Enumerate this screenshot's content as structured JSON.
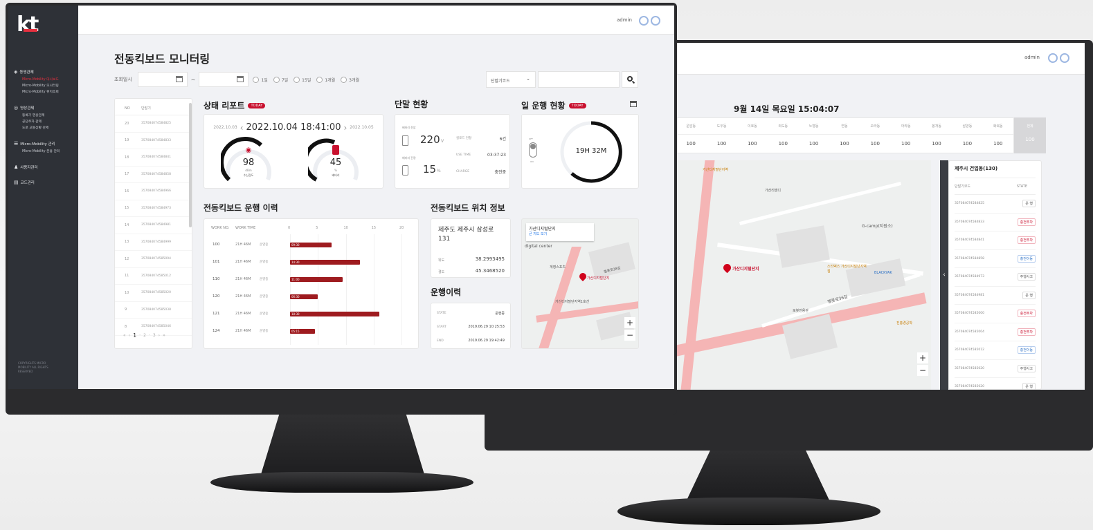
{
  "back": {
    "admin": "admin",
    "datetime": "9월 14일 목요일 15:04:07",
    "top_header": [
      "운암동",
      "도두동",
      "이호동",
      "외도동",
      "노형동",
      "연동",
      "오라동",
      "아라동",
      "봉개동",
      "삼양동",
      "화북동"
    ],
    "top_values": [
      "100",
      "100",
      "100",
      "100",
      "100",
      "100",
      "100",
      "100",
      "100",
      "100",
      "100"
    ],
    "total_header": "전체",
    "total_value": "100",
    "panel_title": "제주시 건입동(130)",
    "panel_cols": [
      "단말기코드",
      "STATE"
    ],
    "panel_rows": [
      {
        "code": "357084074584825",
        "state": "운 행"
      },
      {
        "code": "357084074584833",
        "state": "충전주차"
      },
      {
        "code": "357084074584841",
        "state": "충전주차"
      },
      {
        "code": "357084074584858",
        "state": "충전이동"
      },
      {
        "code": "357084074584973",
        "state": "주행사고"
      },
      {
        "code": "357084074584981",
        "state": "운 행"
      },
      {
        "code": "357084074585000",
        "state": "충전주차"
      },
      {
        "code": "357084074585004",
        "state": "충전주차"
      },
      {
        "code": "357084074585012",
        "state": "충전이동"
      },
      {
        "code": "357084074585020",
        "state": "주행사고"
      },
      {
        "code": "357084074585020",
        "state": "운 행"
      }
    ],
    "map_labels": [
      "가산디지털단지",
      "G-camp(지원소)",
      "BLACKYAK",
      "스타벅스 가산디지털단지역점",
      "로봇전용관",
      "진흥경공학",
      "가산리앤디",
      "벨롯로36길",
      "가산디지털단지역"
    ]
  },
  "front": {
    "logo": "kt",
    "admin": "admin",
    "nav": [
      {
        "group": "동영관제",
        "items": [
          "Micro-Mobility 대시보드",
          "Micro-Mobility 모니터링",
          "Micro-Mobility 위치조회"
        ]
      },
      {
        "group": "영상관제",
        "items": [
          "등록기 영상관제",
          "공단주차 관제",
          "도로 교통상황 관제"
        ]
      },
      {
        "group": "Micro-Mobility 관리",
        "items": [
          "Micro-Mobility 운용 관리"
        ]
      },
      {
        "group": "사용자관리",
        "items": []
      },
      {
        "group": "코드관리",
        "items": []
      }
    ],
    "copyright": "COPYRIGHTS MICRO MOBILITY ALL RIGHTS RESERVED",
    "page_title": "전동킥보드 모니터링",
    "filter": {
      "label": "조회일시",
      "tilde": "~",
      "periods": [
        "1일",
        "7일",
        "15일",
        "1개월",
        "3개월"
      ],
      "select": "단말기코드"
    },
    "list": {
      "cols": [
        "NO",
        "단말기"
      ],
      "rows": [
        {
          "no": "20",
          "code": "357084074584825"
        },
        {
          "no": "19",
          "code": "357084074584833"
        },
        {
          "no": "18",
          "code": "357084074584841"
        },
        {
          "no": "17",
          "code": "357084074584858"
        },
        {
          "no": "16",
          "code": "357084074584966"
        },
        {
          "no": "15",
          "code": "357084074584973"
        },
        {
          "no": "14",
          "code": "357084074584981"
        },
        {
          "no": "13",
          "code": "357084074584999"
        },
        {
          "no": "12",
          "code": "357084074585004"
        },
        {
          "no": "11",
          "code": "357084074585012"
        },
        {
          "no": "10",
          "code": "357084074585020"
        },
        {
          "no": "9",
          "code": "357084074585038"
        },
        {
          "no": "8",
          "code": "357084074585046"
        }
      ],
      "pager": [
        "1",
        "2",
        "3"
      ]
    },
    "status": {
      "title": "상태 리포트",
      "badge": "TODAY",
      "prev_date": "2022.10.03",
      "date": "2022.10.04 18:41:00",
      "next_date": "2022.10.05",
      "gauge1": {
        "value": "98",
        "unit": "dBm",
        "label": "수신감도"
      },
      "gauge2": {
        "value": "45",
        "unit": "%",
        "label": "배터리"
      }
    },
    "device": {
      "title": "단말 현황",
      "voltage_label": "배터리 전압",
      "voltage": "220",
      "voltage_unit": "V",
      "battery_label": "배터리 잔량",
      "battery": "15",
      "battery_unit": "%",
      "kv": [
        {
          "k": "킬로드 현황",
          "v": "6건"
        },
        {
          "k": "USE TIME",
          "v": "03:37:23"
        },
        {
          "k": "CHARGE",
          "v": "충전중"
        }
      ]
    },
    "daily": {
      "title": "일 운행 현황",
      "badge": "TODAY",
      "time": "19H 32M",
      "toggle_on": "OFF",
      "toggle_off": "ON"
    },
    "history": {
      "title": "전동킥보드 운행 이력",
      "cols": [
        "WORK NO.",
        "WORK TIME"
      ],
      "ticks": [
        "0",
        "5",
        "10",
        "15",
        "20"
      ],
      "rows": [
        {
          "no": "100",
          "time": "21H 46M",
          "state": "운영중",
          "bar_label": "09:30",
          "value": 7.5
        },
        {
          "no": "101",
          "time": "21H 46M",
          "state": "운영중",
          "bar_label": "14:30",
          "value": 12.5
        },
        {
          "no": "110",
          "time": "21H 46M",
          "state": "운영중",
          "bar_label": "11:00",
          "value": 9.5
        },
        {
          "no": "120",
          "time": "21H 46M",
          "state": "운영중",
          "bar_label": "06:30",
          "value": 5
        },
        {
          "no": "121",
          "time": "21H 46M",
          "state": "운영중",
          "bar_label": "18:30",
          "value": 16
        },
        {
          "no": "124",
          "time": "21H 46M",
          "state": "운영중",
          "bar_label": "05:15",
          "value": 4.5
        }
      ]
    },
    "location": {
      "title": "전동킥보드 위치 정보",
      "address": "제주도 제주시 삼성로 131",
      "lat_label": "위도",
      "lat": "38.2993495",
      "lng_label": "경도",
      "lng": "45.3468520"
    },
    "run": {
      "title": "운행이력",
      "rows": [
        {
          "k": "STATE",
          "v": "운행중"
        },
        {
          "k": "START",
          "v": "2019.06.29 10:25:53"
        },
        {
          "k": "END",
          "v": "2019.06.29 19:42:49"
        }
      ]
    },
    "map": {
      "popup_title": "가산디지털단지",
      "popup_link": "큰 지도 보기",
      "pin_label": "가산디지털단지",
      "labels": [
        "digital center",
        "가산디지털단지역1호선",
        "계영스포츠",
        "벨롯로38길"
      ]
    }
  },
  "colors": {
    "accent": "#c8102e",
    "sidebar": "#2e3137",
    "bar": "#9e1b1f"
  }
}
